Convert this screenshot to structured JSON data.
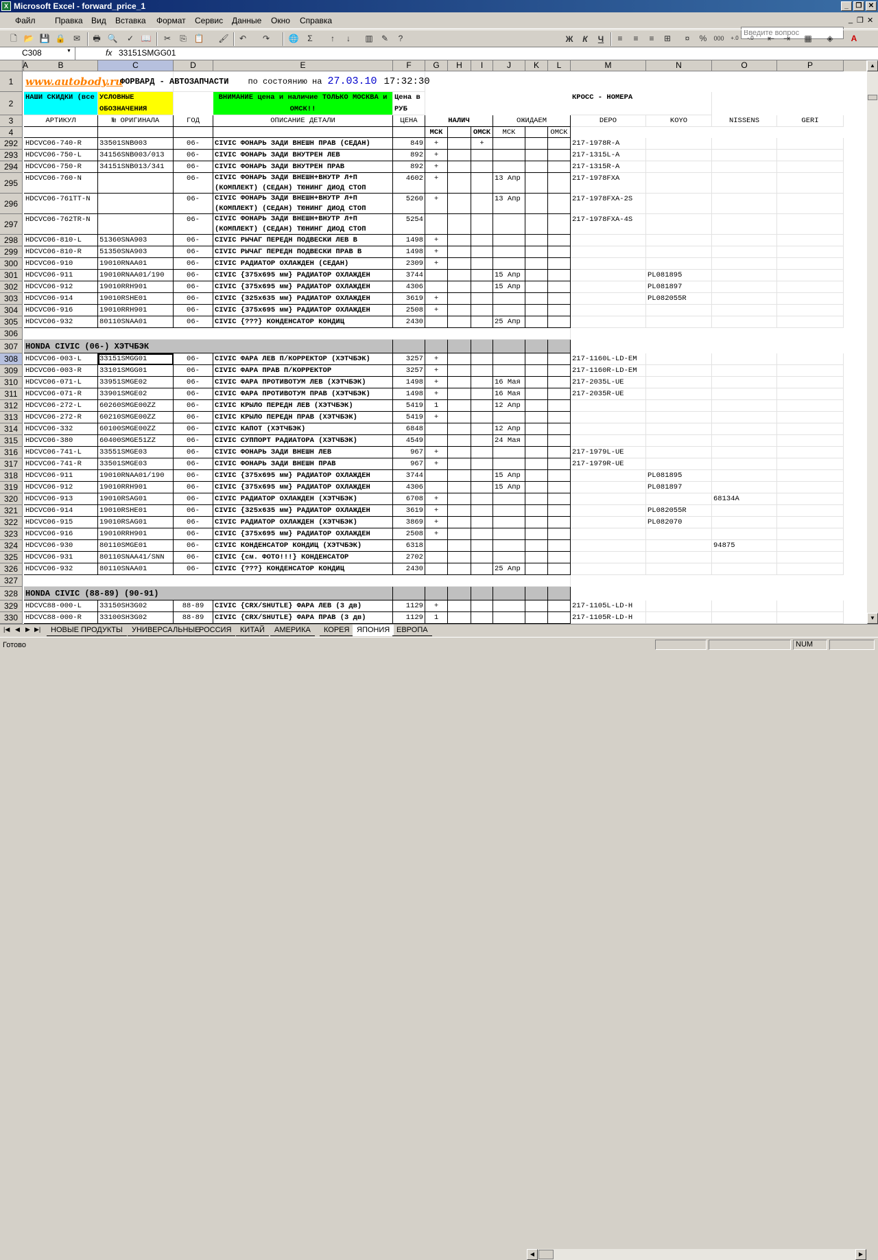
{
  "window": {
    "title": "Microsoft Excel - forward_price_1",
    "app_icon": "X"
  },
  "menu": [
    "Файл",
    "Правка",
    "Вид",
    "Вставка",
    "Формат",
    "Сервис",
    "Данные",
    "Окно",
    "Справка"
  ],
  "help_placeholder": "Введите вопрос",
  "format_toolbar": {
    "font": "Courier New Cyr",
    "size": "8",
    "bold": "Ж",
    "italic": "К",
    "underline": "Ч"
  },
  "name_box": "C308",
  "fx": "fx",
  "formula": "33151SMGG01",
  "columns": [
    "A",
    "B",
    "C",
    "D",
    "E",
    "F",
    "G",
    "H",
    "I",
    "J",
    "K",
    "L",
    "M",
    "N",
    "O",
    "P"
  ],
  "header": {
    "site": "www.autobody.ru",
    "company": "ФОРВАРД - АВТОЗАПЧАСТИ",
    "state_label": "по состоянию на",
    "date": "27.03.10",
    "time": "17:32:30",
    "discounts": "НАШИ СКИДКИ (все",
    "notation": "УСЛОВНЫЕ ОБОЗНАЧЕНИЯ",
    "attention": "ВНИМАНИЕ цена и наличие ТОЛЬКО МОСКВА и ОМСК!!",
    "price_rub": "Цена в РУБ",
    "cross": "КРОСС - НОМЕРА",
    "col_article": "АРТИКУЛ",
    "col_original": "№ ОРИГИНАЛА",
    "col_year": "ГОД",
    "col_desc": "ОПИСАНИЕ ДЕТАЛИ",
    "col_price": "ЦЕНА",
    "col_nalich": "НАЛИЧ",
    "col_expect": "ОЖИДАЕМ",
    "col_depo": "DEPO",
    "col_koyo": "KOYO",
    "col_nissens": "NISSENS",
    "col_geri": "GERI",
    "msk": "МСК",
    "omsk": "ОМСК"
  },
  "rows": [
    {
      "n": "292",
      "art": "HDCVC06-740-R",
      "orig": "33501SNB003",
      "year": "06-",
      "desc": "CIVIC ФОНАРЬ ЗАДИ ВНЕШН ПРАВ (СЕДАН)",
      "price": "849",
      "g": "+",
      "h": "",
      "i": "+",
      "j": "",
      "depo": "217-1978R-A",
      "koyo": "",
      "nissens": ""
    },
    {
      "n": "293",
      "art": "HDCVC06-750-L",
      "orig": "34156SNB003/013",
      "year": "06-",
      "desc": "CIVIC ФОНАРЬ ЗАДИ ВНУТРЕН ЛЕВ",
      "price": "892",
      "g": "+",
      "h": "",
      "i": "",
      "j": "",
      "depo": "217-1315L-A",
      "koyo": "",
      "nissens": ""
    },
    {
      "n": "294",
      "art": "HDCVC06-750-R",
      "orig": "34151SNB013/341",
      "year": "06-",
      "desc": "CIVIC ФОНАРЬ ЗАДИ ВНУТРЕН ПРАВ",
      "price": "892",
      "g": "+",
      "h": "",
      "i": "",
      "j": "",
      "depo": "217-1315R-A",
      "koyo": "",
      "nissens": ""
    },
    {
      "n": "295",
      "art": "HDCVC06-760-N",
      "orig": "",
      "year": "06-",
      "desc": "CIVIC ФОНАРЬ ЗАДИ ВНЕШН+ВНУТР Л+П (КОМПЛЕКТ) (СЕДАН) ТЮНИНГ ДИОД СТОП",
      "price": "4602",
      "g": "+",
      "h": "",
      "i": "",
      "j": "13 Апр",
      "depo": "217-1978FXA",
      "koyo": "",
      "nissens": "",
      "tall": true
    },
    {
      "n": "296",
      "art": "HDCVC06-761TT-N",
      "orig": "",
      "year": "06-",
      "desc": "CIVIC ФОНАРЬ ЗАДИ ВНЕШН+ВНУТР Л+П (КОМПЛЕКТ) (СЕДАН) ТЮНИНГ ДИОД СТОП",
      "price": "5260",
      "g": "+",
      "h": "",
      "i": "",
      "j": "13 Апр",
      "depo": "217-1978FXA-2S",
      "koyo": "",
      "nissens": "",
      "tall": true
    },
    {
      "n": "297",
      "art": "HDCVC06-762TR-N",
      "orig": "",
      "year": "06-",
      "desc": "CIVIC ФОНАРЬ ЗАДИ ВНЕШН+ВНУТР Л+П (КОМПЛЕКТ) (СЕДАН) ТЮНИНГ ДИОД СТОП",
      "price": "5254",
      "g": "",
      "h": "",
      "i": "",
      "j": "",
      "depo": "217-1978FXA-4S",
      "koyo": "",
      "nissens": "",
      "tall": true
    },
    {
      "n": "298",
      "art": "HDCVC06-810-L",
      "orig": "51360SNA903",
      "year": "06-",
      "desc": "CIVIC РЫЧАГ ПЕРЕДН ПОДВЕСКИ ЛЕВ В",
      "price": "1498",
      "g": "+",
      "h": "",
      "i": "",
      "j": "",
      "depo": "",
      "koyo": "",
      "nissens": ""
    },
    {
      "n": "299",
      "art": "HDCVC06-810-R",
      "orig": "51350SNA903",
      "year": "06-",
      "desc": "CIVIC РЫЧАГ ПЕРЕДН ПОДВЕСКИ ПРАВ В",
      "price": "1498",
      "g": "+",
      "h": "",
      "i": "",
      "j": "",
      "depo": "",
      "koyo": "",
      "nissens": ""
    },
    {
      "n": "300",
      "art": "HDCVC06-910",
      "orig": "19010RNAA01",
      "year": "06-",
      "desc": "CIVIC РАДИАТОР ОХЛАЖДЕН (СЕДАН)",
      "price": "2309",
      "g": "+",
      "h": "",
      "i": "",
      "j": "",
      "depo": "",
      "koyo": "",
      "nissens": ""
    },
    {
      "n": "301",
      "art": "HDCVC06-911",
      "orig": "19010RNAA01/190",
      "year": "06-",
      "desc": "CIVIC {375x695 мм} РАДИАТОР ОХЛАЖДЕН",
      "price": "3744",
      "g": "",
      "h": "",
      "i": "",
      "j": "15 Апр",
      "depo": "",
      "koyo": "PL081895",
      "nissens": ""
    },
    {
      "n": "302",
      "art": "HDCVC06-912",
      "orig": "19010RRH901",
      "year": "06-",
      "desc": "CIVIC {375x695 мм} РАДИАТОР ОХЛАЖДЕН",
      "price": "4306",
      "g": "",
      "h": "",
      "i": "",
      "j": "15 Апр",
      "depo": "",
      "koyo": "PL081897",
      "nissens": ""
    },
    {
      "n": "303",
      "art": "HDCVC06-914",
      "orig": "19010RSHE01",
      "year": "06-",
      "desc": "CIVIC {325x635 мм} РАДИАТОР ОХЛАЖДЕН",
      "price": "3619",
      "g": "+",
      "h": "",
      "i": "",
      "j": "",
      "depo": "",
      "koyo": "PL082055R",
      "nissens": ""
    },
    {
      "n": "304",
      "art": "HDCVC06-916",
      "orig": "19010RRH901",
      "year": "06-",
      "desc": "CIVIC {375x695 мм} РАДИАТОР ОХЛАЖДЕН",
      "price": "2508",
      "g": "+",
      "h": "",
      "i": "",
      "j": "",
      "depo": "",
      "koyo": "",
      "nissens": ""
    },
    {
      "n": "305",
      "art": "HDCVC06-932",
      "orig": "80110SNAA01",
      "year": "06-",
      "desc": "CIVIC {???} КОНДЕНСАТОР КОНДИЦ",
      "price": "2430",
      "g": "",
      "h": "",
      "i": "",
      "j": "25 Апр",
      "depo": "",
      "koyo": "",
      "nissens": ""
    },
    {
      "n": "306",
      "blank": true
    },
    {
      "n": "307",
      "section": "HONDA CIVIC (06-) ХЭТЧБЭК"
    },
    {
      "n": "308",
      "art": "HDCVC06-003-L",
      "orig": "33151SMGG01",
      "year": "06-",
      "desc": "CIVIC ФАРА ЛЕВ П/КОРРЕКТОР (ХЭТЧБЭК)",
      "price": "3257",
      "g": "+",
      "h": "",
      "i": "",
      "j": "",
      "depo": "217-1160L-LD-EM",
      "koyo": "",
      "nissens": "",
      "sel": true
    },
    {
      "n": "309",
      "art": "HDCVC06-003-R",
      "orig": "33101SMGG01",
      "year": "06-",
      "desc": "CIVIC ФАРА ПРАВ П/КОРРЕКТОР",
      "price": "3257",
      "g": "+",
      "h": "",
      "i": "",
      "j": "",
      "depo": "217-1160R-LD-EM",
      "koyo": "",
      "nissens": ""
    },
    {
      "n": "310",
      "art": "HDCVC06-071-L",
      "orig": "33951SMGE02",
      "year": "06-",
      "desc": "CIVIC ФАРА ПРОТИВОТУМ ЛЕВ (ХЭТЧБЭК)",
      "price": "1498",
      "g": "+",
      "h": "",
      "i": "",
      "j": "16 Мая",
      "depo": "217-2035L-UE",
      "koyo": "",
      "nissens": ""
    },
    {
      "n": "311",
      "art": "HDCVC06-071-R",
      "orig": "33901SMGE02",
      "year": "06-",
      "desc": "CIVIC ФАРА ПРОТИВОТУМ ПРАВ (ХЭТЧБЭК)",
      "price": "1498",
      "g": "+",
      "h": "",
      "i": "",
      "j": "16 Мая",
      "depo": "217-2035R-UE",
      "koyo": "",
      "nissens": ""
    },
    {
      "n": "312",
      "art": "HDCVC06-272-L",
      "orig": "60260SMGE00ZZ",
      "year": "06-",
      "desc": "CIVIC КРЫЛО ПЕРЕДН ЛЕВ (ХЭТЧБЭК)",
      "price": "5419",
      "g": "1",
      "h": "",
      "i": "",
      "j": "12 Апр",
      "depo": "",
      "koyo": "",
      "nissens": ""
    },
    {
      "n": "313",
      "art": "HDCVC06-272-R",
      "orig": "60210SMGE00ZZ",
      "year": "06-",
      "desc": "CIVIC КРЫЛО ПЕРЕДН ПРАВ (ХЭТЧБЭК)",
      "price": "5419",
      "g": "+",
      "h": "",
      "i": "",
      "j": "",
      "depo": "",
      "koyo": "",
      "nissens": ""
    },
    {
      "n": "314",
      "art": "HDCVC06-332",
      "orig": "60100SMGE00ZZ",
      "year": "06-",
      "desc": "CIVIC КАПОТ (ХЭТЧБЭК)",
      "price": "6848",
      "g": "",
      "h": "",
      "i": "",
      "j": "12 Апр",
      "depo": "",
      "koyo": "",
      "nissens": ""
    },
    {
      "n": "315",
      "art": "HDCVC06-380",
      "orig": "60400SMGE51ZZ",
      "year": "06-",
      "desc": "CIVIC СУППОРТ РАДИАТОРА (ХЭТЧБЭК)",
      "price": "4549",
      "g": "",
      "h": "",
      "i": "",
      "j": "24 Мая",
      "depo": "",
      "koyo": "",
      "nissens": ""
    },
    {
      "n": "316",
      "art": "HDCVC06-741-L",
      "orig": "33551SMGE03",
      "year": "06-",
      "desc": "CIVIC ФОНАРЬ ЗАДИ ВНЕШН ЛЕВ",
      "price": "967",
      "g": "+",
      "h": "",
      "i": "",
      "j": "",
      "depo": "217-1979L-UE",
      "koyo": "",
      "nissens": ""
    },
    {
      "n": "317",
      "art": "HDCVC06-741-R",
      "orig": "33501SMGE03",
      "year": "06-",
      "desc": "CIVIC ФОНАРЬ ЗАДИ ВНЕШН ПРАВ",
      "price": "967",
      "g": "+",
      "h": "",
      "i": "",
      "j": "",
      "depo": "217-1979R-UE",
      "koyo": "",
      "nissens": ""
    },
    {
      "n": "318",
      "art": "HDCVC06-911",
      "orig": "19010RNAA01/190",
      "year": "06-",
      "desc": "CIVIC {375x695 мм} РАДИАТОР ОХЛАЖДЕН",
      "price": "3744",
      "g": "",
      "h": "",
      "i": "",
      "j": "15 Апр",
      "depo": "",
      "koyo": "PL081895",
      "nissens": ""
    },
    {
      "n": "319",
      "art": "HDCVC06-912",
      "orig": "19010RRH901",
      "year": "06-",
      "desc": "CIVIC {375x695 мм} РАДИАТОР ОХЛАЖДЕН",
      "price": "4306",
      "g": "",
      "h": "",
      "i": "",
      "j": "15 Апр",
      "depo": "",
      "koyo": "PL081897",
      "nissens": ""
    },
    {
      "n": "320",
      "art": "HDCVC06-913",
      "orig": "19010RSAG01",
      "year": "06-",
      "desc": "CIVIC РАДИАТОР ОХЛАЖДЕН (ХЭТЧБЭК)",
      "price": "6708",
      "g": "+",
      "h": "",
      "i": "",
      "j": "",
      "depo": "",
      "koyo": "",
      "nissens": "68134A"
    },
    {
      "n": "321",
      "art": "HDCVC06-914",
      "orig": "19010RSHE01",
      "year": "06-",
      "desc": "CIVIC {325x635 мм} РАДИАТОР ОХЛАЖДЕН",
      "price": "3619",
      "g": "+",
      "h": "",
      "i": "",
      "j": "",
      "depo": "",
      "koyo": "PL082055R",
      "nissens": ""
    },
    {
      "n": "322",
      "art": "HDCVC06-915",
      "orig": "19010RSAG01",
      "year": "06-",
      "desc": "CIVIC РАДИАТОР ОХЛАЖДЕН (ХЭТЧБЭК)",
      "price": "3869",
      "g": "+",
      "h": "",
      "i": "",
      "j": "",
      "depo": "",
      "koyo": "PL082070",
      "nissens": ""
    },
    {
      "n": "323",
      "art": "HDCVC06-916",
      "orig": "19010RRH901",
      "year": "06-",
      "desc": "CIVIC {375x695 мм} РАДИАТОР ОХЛАЖДЕН",
      "price": "2508",
      "g": "+",
      "h": "",
      "i": "",
      "j": "",
      "depo": "",
      "koyo": "",
      "nissens": ""
    },
    {
      "n": "324",
      "art": "HDCVC06-930",
      "orig": "80110SMGE01",
      "year": "06-",
      "desc": "CIVIC КОНДЕНСАТОР КОНДИЦ (ХЭТЧБЭК)",
      "price": "6318",
      "g": "",
      "h": "",
      "i": "",
      "j": "",
      "depo": "",
      "koyo": "",
      "nissens": "94875"
    },
    {
      "n": "325",
      "art": "HDCVC06-931",
      "orig": "80110SNAA41/SNN",
      "year": "06-",
      "desc": "CIVIC {см. ФОТО!!!} КОНДЕНСАТОР",
      "price": "2702",
      "g": "",
      "h": "",
      "i": "",
      "j": "",
      "depo": "",
      "koyo": "",
      "nissens": ""
    },
    {
      "n": "326",
      "art": "HDCVC06-932",
      "orig": "80110SNAA01",
      "year": "06-",
      "desc": "CIVIC {???} КОНДЕНСАТОР КОНДИЦ",
      "price": "2430",
      "g": "",
      "h": "",
      "i": "",
      "j": "25 Апр",
      "depo": "",
      "koyo": "",
      "nissens": ""
    },
    {
      "n": "327",
      "blank": true
    },
    {
      "n": "328",
      "section": "HONDA CIVIC (88-89) (90-91)"
    },
    {
      "n": "329",
      "art": "HDCVC88-000-L",
      "orig": "33150SH3G02",
      "year": "88-89",
      "desc": "CIVIC {CRX/SHUTLE} ФАРА ЛЕВ (3 дв)",
      "price": "1129",
      "g": "+",
      "h": "",
      "i": "",
      "j": "",
      "depo": "217-1105L-LD-H",
      "koyo": "",
      "nissens": ""
    },
    {
      "n": "330",
      "art": "HDCVC88-000-R",
      "orig": "33100SH3G02",
      "year": "88-89",
      "desc": "CIVIC {CRX/SHUTLE} ФАРА ПРАВ (3 дв)",
      "price": "1129",
      "g": "1",
      "h": "",
      "i": "",
      "j": "",
      "depo": "217-1105R-LD-H",
      "koyo": "",
      "nissens": ""
    }
  ],
  "sheets": [
    "НОВЫЕ ПРОДУКТЫ",
    "УНИВЕРСАЛЬНЫЕ",
    "РОССИЯ",
    "КИТАЙ",
    "АМЕРИКА",
    "КОРЕЯ",
    "ЯПОНИЯ",
    "ЕВРОПА"
  ],
  "active_sheet": "ЯПОНИЯ",
  "status": {
    "ready": "Готово",
    "num": "NUM"
  },
  "colors": {
    "title_bg": "#0a246a",
    "cyan": "#00ffff",
    "yellow": "#ffff00",
    "green": "#00ff00",
    "section": "#c0c0c0",
    "site": "#ff8000",
    "date": "#0000cc"
  }
}
